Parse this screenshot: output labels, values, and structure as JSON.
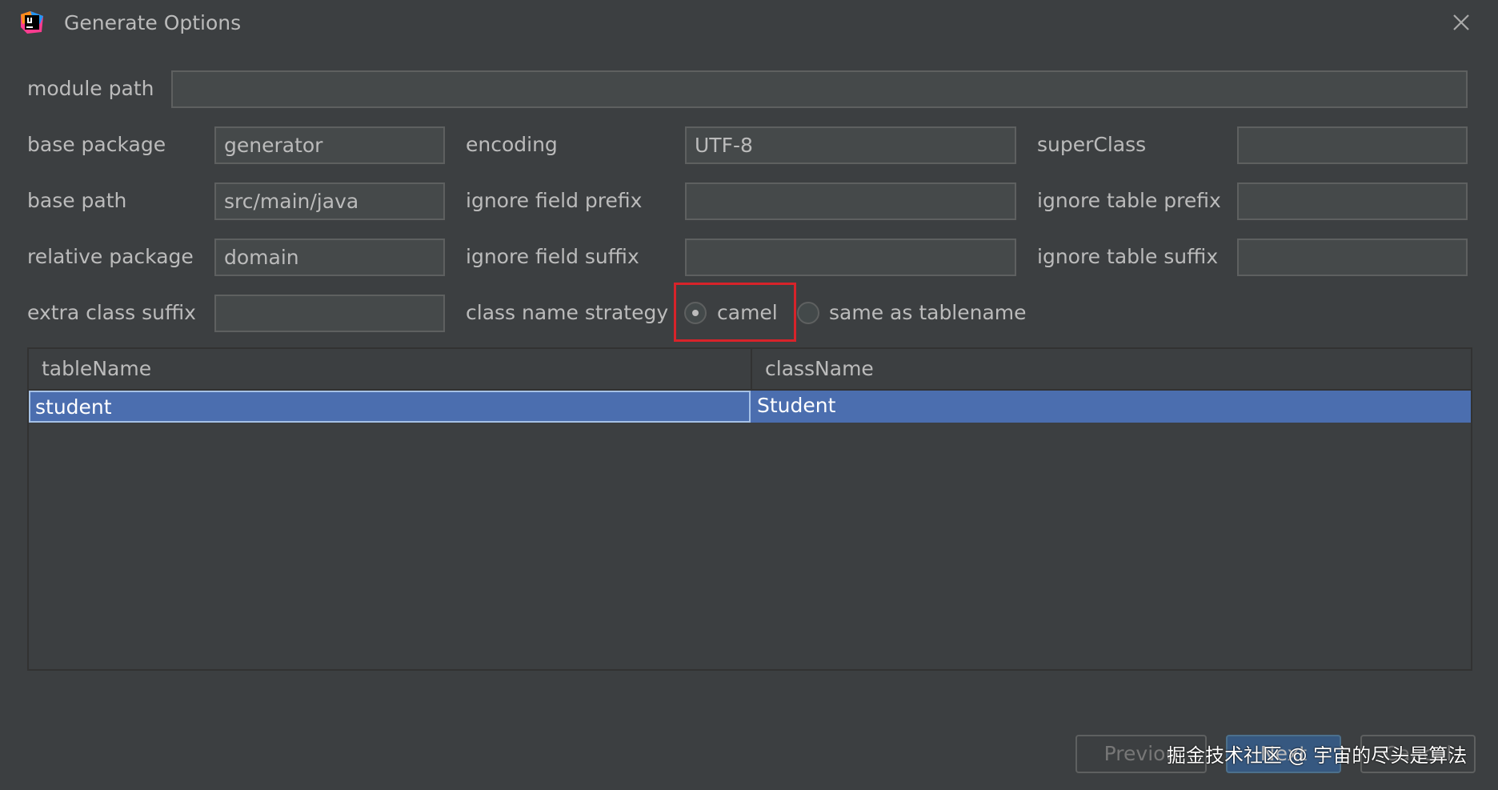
{
  "window": {
    "title": "Generate Options"
  },
  "form": {
    "module_path": {
      "label": "module path",
      "value": ""
    },
    "base_package": {
      "label": "base package",
      "value": "generator"
    },
    "encoding": {
      "label": "encoding",
      "value": "UTF-8"
    },
    "super_class": {
      "label": "superClass",
      "value": ""
    },
    "base_path": {
      "label": "base path",
      "value": "src/main/java"
    },
    "ignore_field_prefix": {
      "label": "ignore field prefix",
      "value": ""
    },
    "ignore_table_prefix": {
      "label": "ignore table prefix",
      "value": ""
    },
    "relative_package": {
      "label": "relative package",
      "value": "domain"
    },
    "ignore_field_suffix": {
      "label": "ignore field suffix",
      "value": ""
    },
    "ignore_table_suffix": {
      "label": "ignore table suffix",
      "value": ""
    },
    "extra_class_suffix": {
      "label": "extra class suffix",
      "value": ""
    },
    "class_name_strategy": {
      "label": "class name strategy",
      "options": [
        "camel",
        "same as tablename"
      ],
      "selected": "camel"
    }
  },
  "table": {
    "columns": [
      "tableName",
      "className"
    ],
    "rows": [
      {
        "tableName": "student",
        "className": "Student",
        "selected": true
      }
    ]
  },
  "buttons": {
    "previous": "Previou",
    "next": "Next",
    "cancel": "Cancel"
  },
  "watermark": "掘金技术社区 @ 宇宙的尽头是算法",
  "colors": {
    "background": "#3c3f41",
    "field_bg": "#45494a",
    "selection": "#4b6eaf",
    "highlight_box": "#d8232a",
    "primary_button": "#365880"
  }
}
